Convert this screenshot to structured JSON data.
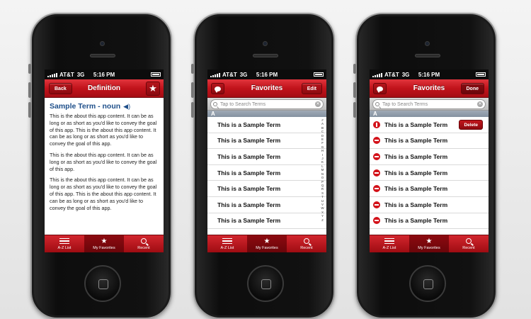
{
  "status": {
    "carrier": "AT&T",
    "network": "3G",
    "time": "5:16 PM"
  },
  "tabs": {
    "az": "A-Z List",
    "favorites": "My Favorites",
    "recent": "Recent"
  },
  "screen1": {
    "back": "Back",
    "title": "Definition",
    "term": "Sample Term - noun",
    "paragraphs": [
      "This is the about this app content. It can be as long or as short as you'd like to convey the goal of this app. This is the about this app content. It can be as long or as short as you'd like to convey the goal of this app.",
      "This is the about this app content. It can be as long or as short as you'd like to convey the goal of this app.",
      "This is the about this app content. It can be as long or as short as you'd like to convey the goal of this app. This is the about this app content. It can be as long or as short as you'd like to convey the goal of this app."
    ]
  },
  "screen2": {
    "title": "Favorites",
    "edit": "Edit",
    "search_placeholder": "Tap to Search Terms",
    "section": "A",
    "rows": [
      "This is a Sample Term",
      "This is a Sample Term",
      "This is a Sample Term",
      "This is a Sample Term",
      "This is a Sample Term",
      "This is a Sample Term",
      "This is a Sample Term"
    ],
    "index": [
      "#",
      "A",
      "B",
      "C",
      "D",
      "E",
      "F",
      "G",
      "H",
      "I",
      "J",
      "K",
      "L",
      "M",
      "N",
      "O",
      "P",
      "Q",
      "R",
      "S",
      "T",
      "U",
      "V",
      "W",
      "X",
      "Y",
      "Z"
    ]
  },
  "screen3": {
    "title": "Favorites",
    "done": "Done",
    "search_placeholder": "Tap to Search Terms",
    "section": "A",
    "delete": "Delete",
    "rows": [
      "This is a Sample Term",
      "This is a Sample Term",
      "This is a Sample Term",
      "This is a Sample Term",
      "This is a Sample Term",
      "This is a Sample Term",
      "This is a Sample Term"
    ]
  },
  "colors": {
    "accent": "#c1131b",
    "term_blue": "#1e4f8a"
  }
}
